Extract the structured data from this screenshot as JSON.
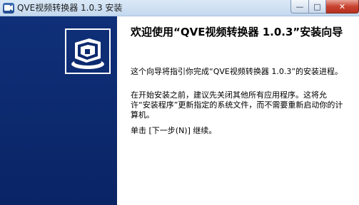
{
  "window": {
    "title": "QVE视频转换器 1.0.3 安装",
    "icon": "app-icon"
  },
  "controls": {
    "minimize": "—",
    "maximize": "□",
    "close": "✕"
  },
  "welcome": {
    "heading": "欢迎使用“QVE视频转换器 1.0.3”安装向导",
    "paragraph1": "这个向导将指引你完成“QVE视频转换器 1.0.3”的安装进程。",
    "paragraph2": "在开始安装之前，建议先关闭其他所有应用程序。这将允许“安装程序”更新指定的系统文件，而不需要重新启动你的计算机。",
    "paragraph3": "单击 [下一步(N)] 继续。"
  },
  "banner": {
    "logo_icon": "installer-box-icon",
    "background_color": "#0c2a6e"
  }
}
